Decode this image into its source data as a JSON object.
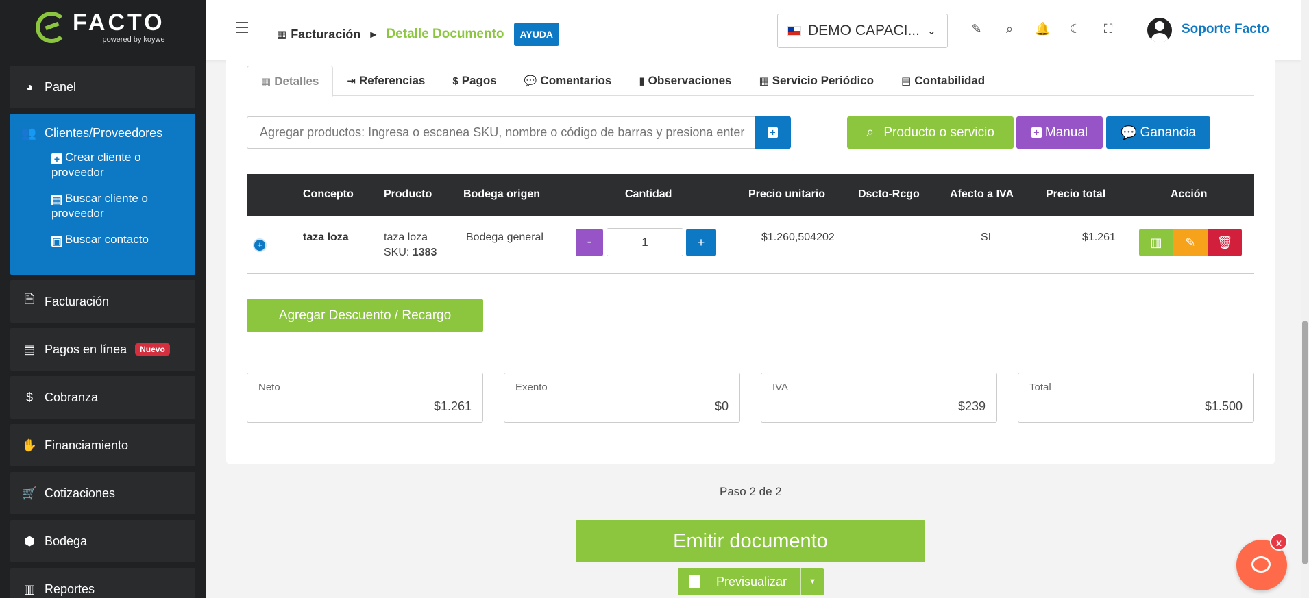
{
  "brand": {
    "name": "FACTO",
    "powered": "powered by koywe"
  },
  "sidebar": {
    "items": [
      {
        "label": "Panel",
        "icon": "◕"
      },
      {
        "label": "Clientes/Proveedores",
        "icon": "👥"
      },
      {
        "label": "Facturación",
        "icon": "🗎"
      },
      {
        "label": "Pagos en línea",
        "icon": "▤",
        "badge": "Nuevo"
      },
      {
        "label": "Cobranza",
        "icon": "$"
      },
      {
        "label": "Financiamiento",
        "icon": "✋"
      },
      {
        "label": "Cotizaciones",
        "icon": "🛒"
      },
      {
        "label": "Bodega",
        "icon": "⬢"
      },
      {
        "label": "Reportes",
        "icon": "▥"
      }
    ],
    "subitems": [
      {
        "label": "Crear cliente o proveedor",
        "icon": "+"
      },
      {
        "label": "Buscar cliente o proveedor",
        "icon": "▦"
      },
      {
        "label": "Buscar contacto",
        "icon": "▣"
      }
    ]
  },
  "header": {
    "breadcrumb_parent": "Facturación",
    "breadcrumb_current": "Detalle Documento",
    "help_label": "AYUDA",
    "company_selector": "DEMO CAPACI...",
    "user_name": "Soporte Facto"
  },
  "tabs": [
    {
      "label": "Detalles",
      "icon": "▦"
    },
    {
      "label": "Referencias",
      "icon": "⇥"
    },
    {
      "label": "Pagos",
      "icon": "$"
    },
    {
      "label": "Comentarios",
      "icon": "💬"
    },
    {
      "label": "Observaciones",
      "icon": "▮"
    },
    {
      "label": "Servicio Periódico",
      "icon": "▦"
    },
    {
      "label": "Contabilidad",
      "icon": "▤"
    }
  ],
  "product_search": {
    "placeholder": "Agregar productos: Ingresa o escanea SKU, nombre o código de barras y presiona enter"
  },
  "buttons": {
    "product_or_service": "Producto o servicio",
    "manual": "Manual",
    "profit": "Ganancia",
    "add_discount": "Agregar Descuento / Recargo",
    "emit": "Emitir documento",
    "preview": "Previsualizar"
  },
  "table": {
    "headers": [
      "Concepto",
      "Producto",
      "Bodega origen",
      "Cantidad",
      "Precio unitario",
      "Dscto-Rcgo",
      "Afecto a IVA",
      "Precio total",
      "Acción"
    ],
    "rows": [
      {
        "concept": "taza loza",
        "product": "taza loza",
        "sku_label": "SKU:",
        "sku": "1383",
        "warehouse": "Bodega general",
        "quantity": "1",
        "unit_price": "$1.260,504202",
        "discount": "",
        "vat": "SI",
        "total": "$1.261"
      }
    ]
  },
  "totals": {
    "neto_label": "Neto",
    "neto": "$1.261",
    "exento_label": "Exento",
    "exento": "$0",
    "iva_label": "IVA",
    "iva": "$239",
    "total_label": "Total",
    "total": "$1.500"
  },
  "step": "Paso 2 de 2",
  "chat": {
    "close": "x"
  },
  "colors": {
    "green": "#8cc63f",
    "blue": "#0d78c4",
    "purple": "#9654c6",
    "orange": "#f7a21b",
    "red": "#d21f3c"
  }
}
